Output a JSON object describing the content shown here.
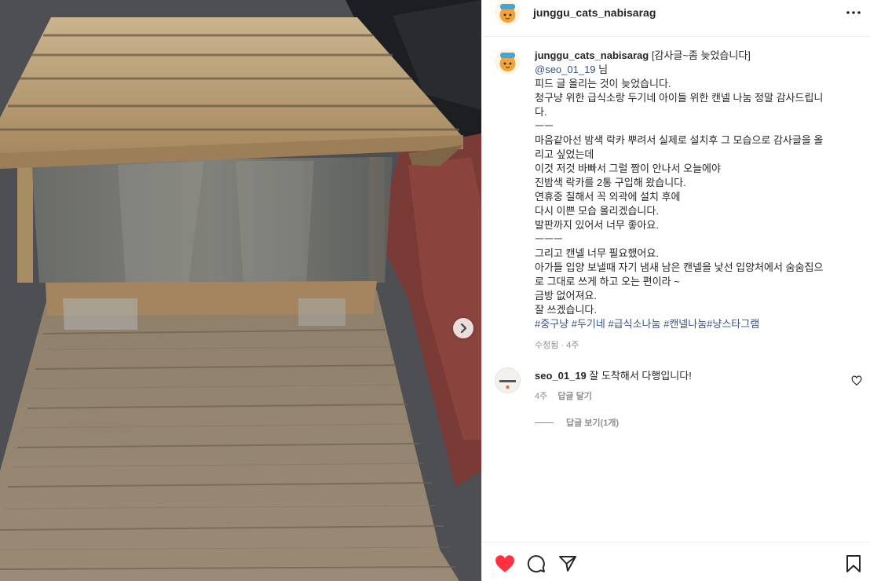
{
  "post": {
    "username": "junggu_cats_nabisarag",
    "more_icon": "more-horizontal-icon"
  },
  "caption": {
    "author": "junggu_cats_nabisarag",
    "title": "[감사글~좀 늦었습니다]",
    "mention": "@seo_01_19",
    "mention_suffix": " 님",
    "lines": [
      "피드 글 올리는 것이 늦었습니다.",
      "청구냥 위한 급식소랑 두기네 아이들 위한 캔넬 나눔 정말 감사드립니",
      "다.",
      "ㅡㅡ",
      "마음같아선 밤색 락카 뿌려서 실제로 설치후 그 모습으로 감사글을 올",
      "리고 싶었는데",
      "이것 저것 바빠서 그럴 짬이 안나서 오늘에야",
      "진밤색 락카를 2통 구입해 왔습니다.",
      "연휴중 칠해서 꼭 외곽에 설치 후에",
      "다시 이쁜 모습 올리겠습니다.",
      "발판까지 있어서 너무 좋아요.",
      "ㅡㅡㅡ",
      "그리고 캔넬 너무 필요했어요.",
      "아가들 입양 보낼때 자기 냄새 남은 캔넬을 낯선 입양처에서 숨숨집으",
      "로 그대로 쓰게 하고 오는 편이라 ~",
      "금방 없어져요.",
      "잘 쓰겠습니다."
    ],
    "hashtags": "#중구냥 #두기네 #급식소나눔 #캔넬나눔#냥스타그램",
    "meta": "수정됨 · 4주"
  },
  "comment": {
    "author": "seo_01_19",
    "text": " 잘 도착해서 다행입니다!",
    "time": "4주",
    "reply_label": "답글 달기",
    "view_replies": "답글 보기(1개)"
  },
  "colors": {
    "like_red": "#ff3040",
    "link_blue": "#385185",
    "muted_gray": "#8e8e8e"
  }
}
